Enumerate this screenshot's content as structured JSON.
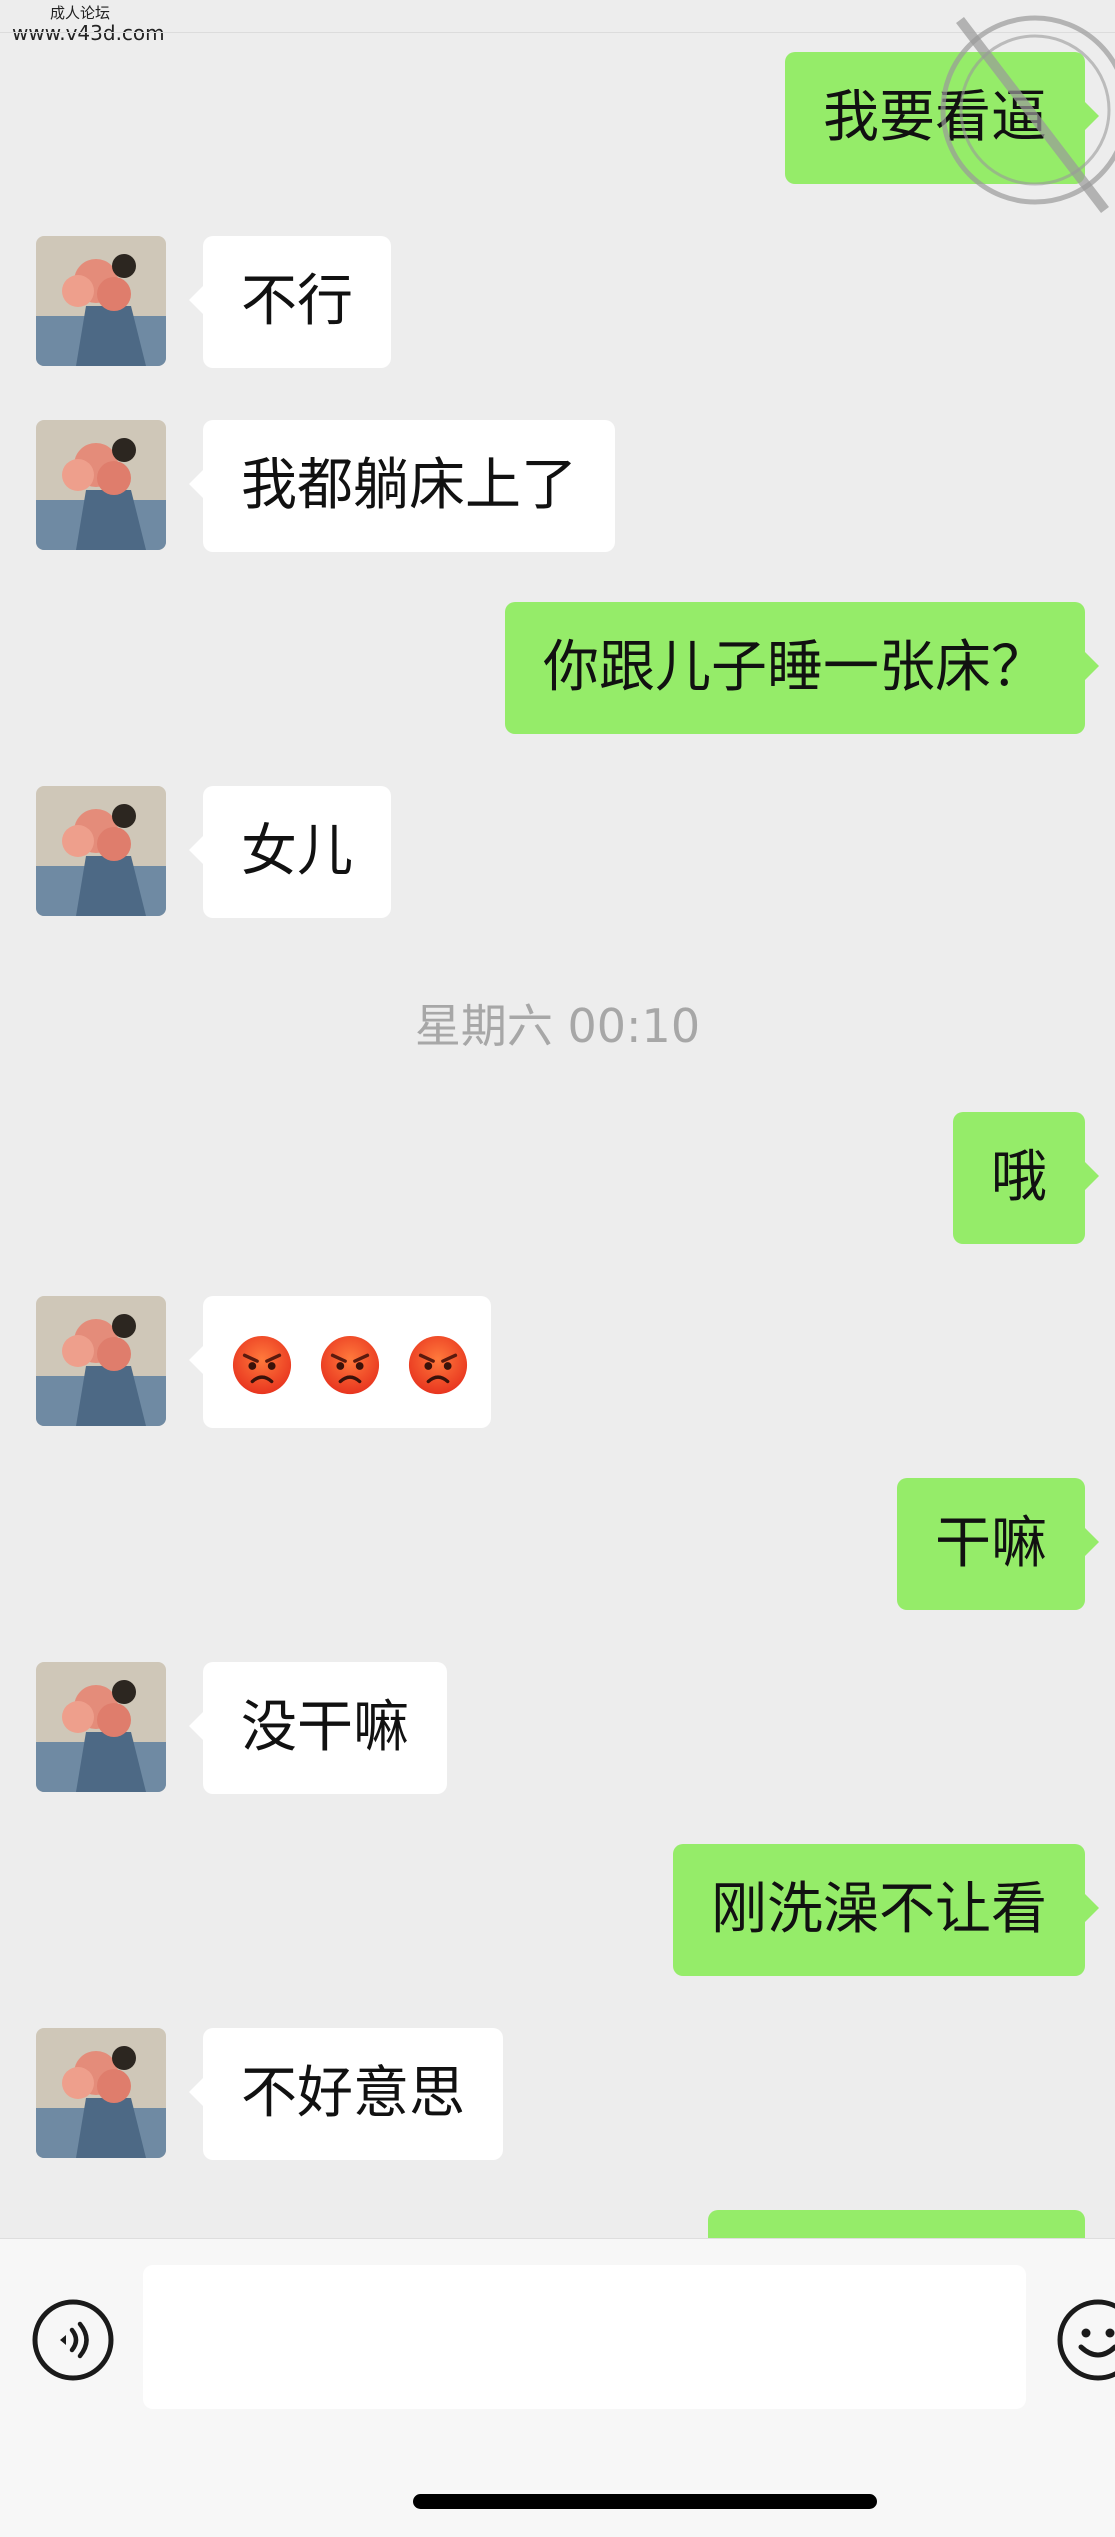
{
  "watermark": {
    "top": "成人论坛",
    "url": "www.v43d.com"
  },
  "messages": [
    {
      "side": "out",
      "text": "我要看逼"
    },
    {
      "side": "in",
      "text": "不行"
    },
    {
      "side": "in",
      "text": "我都躺床上了"
    },
    {
      "side": "out",
      "text": "你跟儿子睡一张床？"
    },
    {
      "side": "in",
      "text": "女儿"
    },
    {
      "side": "out",
      "text": "哦"
    },
    {
      "side": "out",
      "text": "干嘛"
    },
    {
      "side": "in",
      "text": "没干嘛"
    },
    {
      "side": "out",
      "text": "刚洗澡不让看"
    },
    {
      "side": "in",
      "text": "不好意思"
    }
  ],
  "timestamp": "星期六 00:10",
  "input": {
    "placeholder": ""
  },
  "icons": {
    "voice": "voice-icon",
    "emoji": "emoji-icon",
    "angry": "angry-face-icon"
  },
  "colors": {
    "background": "#ededed",
    "outgoing_bubble": "#95ec69",
    "incoming_bubble": "#ffffff"
  }
}
